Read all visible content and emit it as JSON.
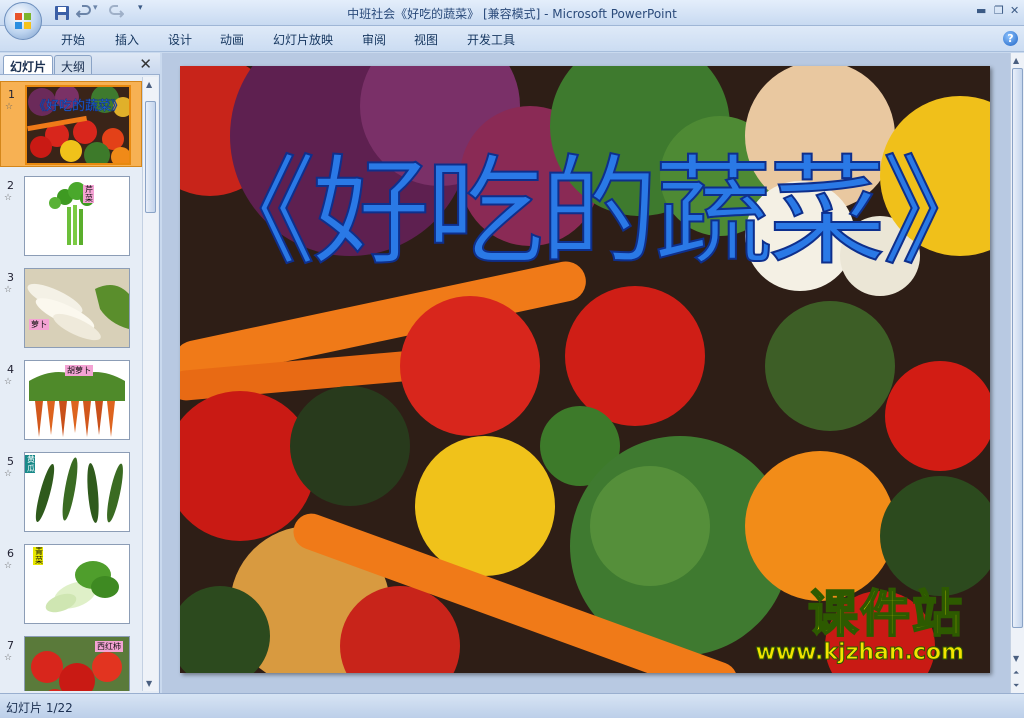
{
  "app": {
    "title": "中班社会《好吃的蔬菜》 [兼容模式] - Microsoft PowerPoint"
  },
  "quick_access": {
    "save_icon": "save-icon",
    "undo_icon": "undo-icon",
    "redo_icon": "redo-icon",
    "customize_icon": "customize-icon"
  },
  "ribbon": {
    "tabs": [
      "开始",
      "插入",
      "设计",
      "动画",
      "幻灯片放映",
      "审阅",
      "视图",
      "开发工具"
    ]
  },
  "panel": {
    "tabs": {
      "slides": "幻灯片",
      "outline": "大纲"
    }
  },
  "thumbnails": [
    {
      "number": "1",
      "label": "《好吃的蔬菜》"
    },
    {
      "number": "2",
      "label": "芹菜"
    },
    {
      "number": "3",
      "label": "萝卜"
    },
    {
      "number": "4",
      "label": "胡萝卜"
    },
    {
      "number": "5",
      "label": "黄瓜"
    },
    {
      "number": "6",
      "label": "青菜"
    },
    {
      "number": "7",
      "label": "西红柿"
    }
  ],
  "slide": {
    "title": "《好吃的蔬菜》",
    "watermark_cn": "课件站",
    "watermark_url": "www.kjzhan.com"
  },
  "status": {
    "text": "幻灯片 1/22"
  },
  "colors": {
    "title_blue": "#2a79e6",
    "watermark_yellow": "#f2e400",
    "selection_orange": "#f7b153"
  }
}
